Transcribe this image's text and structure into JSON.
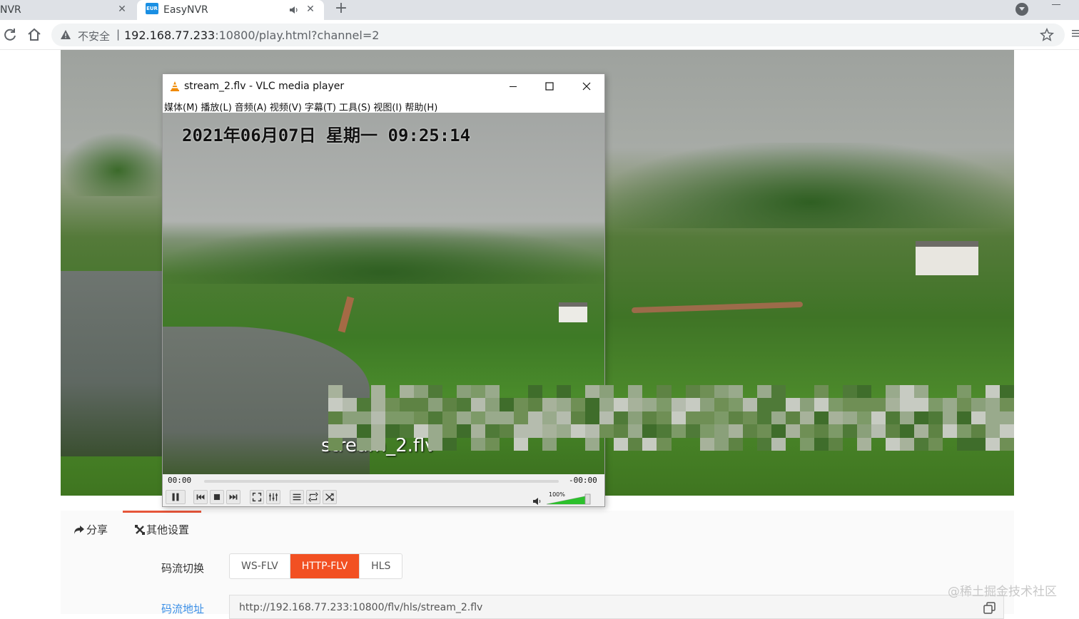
{
  "browser": {
    "tabs": [
      {
        "title": "NVR",
        "active": false
      },
      {
        "title": "EasyNVR",
        "active": true,
        "favicon": "EUR"
      }
    ],
    "address": {
      "security_label": "不安全",
      "separator": "|",
      "url_host": "192.168.77.233",
      "url_rest": ":10800/play.html?channel=2"
    }
  },
  "vlc": {
    "title": "stream_2.flv - VLC media player",
    "menu": [
      "媒体(M)",
      "播放(L)",
      "音频(A)",
      "视频(V)",
      "字幕(T)",
      "工具(S)",
      "视图(I)",
      "帮助(H)"
    ],
    "osd_timestamp": "2021年06月07日 星期一 09:25:14",
    "caption": "stream_2.flv",
    "elapsed": "00:00",
    "remaining": "-00:00",
    "volume": "100%",
    "volume_level": 1.0
  },
  "page": {
    "tabs": {
      "share": "分享",
      "other_settings": "其他设置"
    },
    "stream_switch_label": "码流切换",
    "stream_options": [
      "WS-FLV",
      "HTTP-FLV",
      "HLS"
    ],
    "selected_stream": "HTTP-FLV",
    "stream_address_label": "码流地址",
    "stream_address": "http://192.168.77.233:10800/flv/hls/stream_2.flv",
    "watermark": "@稀土掘金技术社区"
  },
  "colors": {
    "accent": "#f25022",
    "tab_underline": "#e6563a",
    "link": "#3a8ee6"
  },
  "icons": [
    "reload-icon",
    "home-icon",
    "warning-icon",
    "star-icon",
    "mute-icon",
    "close-icon",
    "plus-icon",
    "share-icon",
    "settings-icon",
    "copy-icon",
    "vlc-cone-icon"
  ]
}
